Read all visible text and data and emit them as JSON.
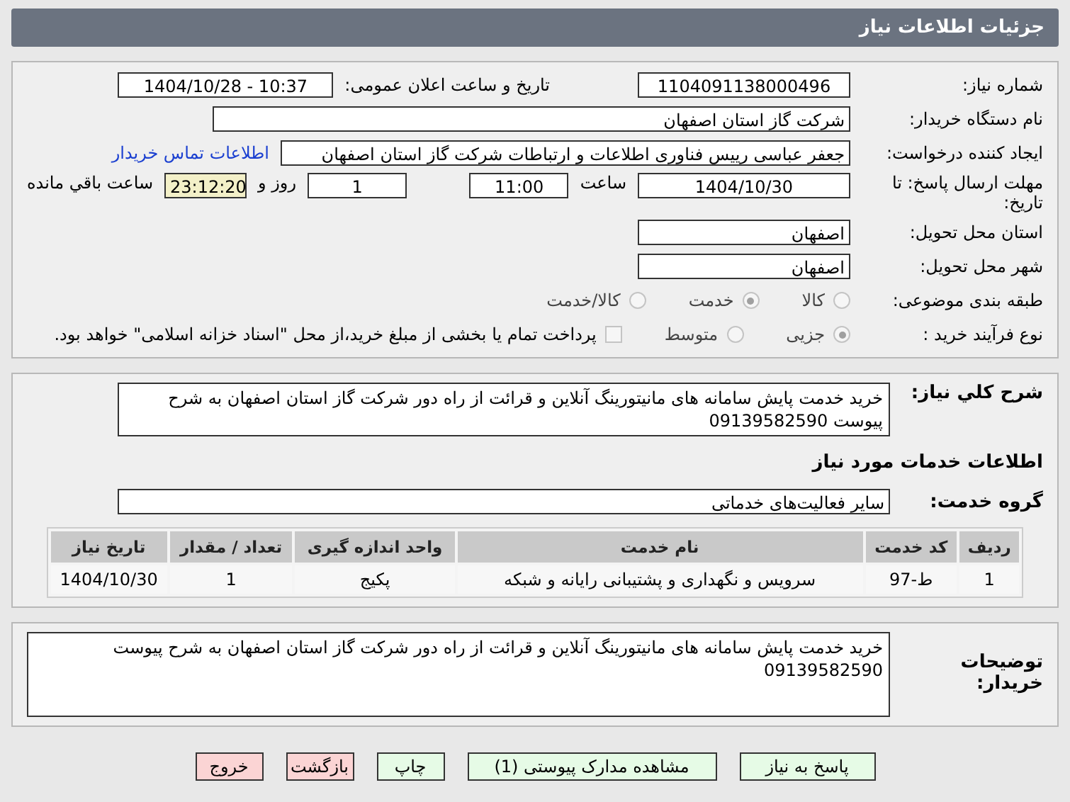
{
  "header": {
    "title": "جزئیات اطلاعات نیاز"
  },
  "details": {
    "need_number": {
      "label": "شماره نیاز:",
      "value": "1104091138000496"
    },
    "announce": {
      "label": "تاریخ و ساعت اعلان عمومی:",
      "value": "1404/10/28 - 10:37"
    },
    "buyer": {
      "label": "نام دستگاه خریدار:",
      "value": "شرکت گاز استان اصفهان"
    },
    "creator": {
      "label": "ایجاد کننده درخواست:",
      "value": "جعفر عباسی رییس فناوری اطلاعات و ارتباطات شرکت گاز استان اصفهان",
      "link": "اطلاعات تماس خریدار"
    },
    "deadline": {
      "label": "مهلت ارسال پاسخ: تا تاریخ:",
      "date": "1404/10/30",
      "time_label": "ساعت",
      "time": "11:00",
      "days": "1",
      "days_label": "روز و",
      "remaining": "23:12:20",
      "remaining_label": "ساعت باقي مانده"
    },
    "province": {
      "label": "استان محل تحویل:",
      "value": "اصفهان"
    },
    "city": {
      "label": "شهر محل تحویل:",
      "value": "اصفهان"
    },
    "category": {
      "label": "طبقه بندی موضوعی:",
      "options": [
        {
          "label": "کالا",
          "selected": false
        },
        {
          "label": "خدمت",
          "selected": true
        },
        {
          "label": "کالا/خدمت",
          "selected": false
        }
      ]
    },
    "process": {
      "label": "نوع فرآیند خرید :",
      "options": [
        {
          "label": "جزیی",
          "selected": true
        },
        {
          "label": "متوسط",
          "selected": false
        }
      ],
      "payment": {
        "checked": false,
        "label": "پرداخت تمام یا بخشی از مبلغ خرید،از محل \"اسناد خزانه اسلامی\" خواهد بود."
      }
    }
  },
  "summary": {
    "label": "شرح کلي نیاز:",
    "value": "خرید خدمت پایش سامانه های مانیتورینگ آنلاین و قرائت از راه دور شرکت گاز استان اصفهان به شرح پیوست 09139582590"
  },
  "services_title": "اطلاعات خدمات مورد نیاز",
  "service_group": {
    "label": "گروه خدمت:",
    "value": "سایر فعالیت‌های خدماتی"
  },
  "table": {
    "columns": [
      "ردیف",
      "کد خدمت",
      "نام خدمت",
      "واحد اندازه گیری",
      "تعداد / مقدار",
      "تاریخ نیاز"
    ],
    "rows": [
      [
        "1",
        "ط-97",
        "سرویس و نگهداری و پشتیبانی رایانه و شبکه",
        "پکیج",
        "1",
        "1404/10/30"
      ]
    ]
  },
  "buyer_notes": {
    "label": "توضیحات خریدار:",
    "value": "خرید خدمت پایش سامانه های مانیتورینگ آنلاین و قرائت از راه دور شرکت گاز استان اصفهان به شرح پیوست 09139582590"
  },
  "buttons": [
    {
      "label": "پاسخ به نیاز",
      "kind": "normal"
    },
    {
      "label": "مشاهده مدارک پیوستی (1)",
      "kind": "normal"
    },
    {
      "label": "چاپ",
      "kind": "normal"
    },
    {
      "label": "بازگشت",
      "kind": "danger"
    },
    {
      "label": "خروج",
      "kind": "danger"
    }
  ]
}
